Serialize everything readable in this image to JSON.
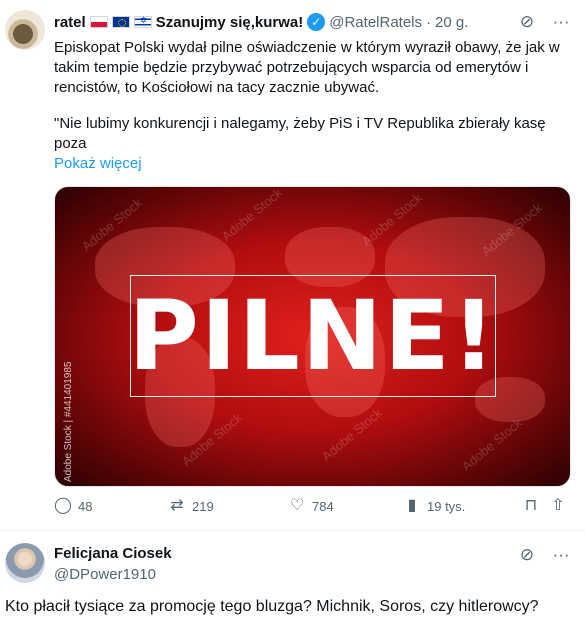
{
  "tweet": {
    "author": {
      "name": "ratel",
      "name_suffix": "Szanujmy się,kurwa!",
      "handle": "@RatelRatels",
      "time": "20 g."
    },
    "flags": [
      "pl-flag",
      "eu-flag",
      "il-flag"
    ],
    "text": "Episkopat Polski wydał pilne oświadczenie w którym wyraził obawy, że jak w takim tempie będzie przybywać potrzebujących wsparcia od emerytów i rencistów, to Kościołowi na tacy zacznie ubywać.",
    "quote": "\"Nie lubimy konkurencji i nalegamy, żeby PiS i TV Republika zbierały kasę poza",
    "show_more": "Pokaż więcej",
    "media": {
      "headline": "PILNE!",
      "watermark": "Adobe Stock",
      "stock_id": "Adobe Stock | #441401985"
    },
    "actions": {
      "replies": "48",
      "reposts": "219",
      "likes": "784",
      "views": "19 tys."
    }
  },
  "reply": {
    "author": {
      "name": "Felicjana Ciosek",
      "handle": "@DPower1910"
    },
    "text": "Kto płacił tysiące za promocję tego bluzga? Michnik, Soros, czy hitlerowcy?"
  },
  "colors": {
    "accent": "#1d9bf0",
    "muted": "#536471",
    "media_red": "#c4121a"
  }
}
